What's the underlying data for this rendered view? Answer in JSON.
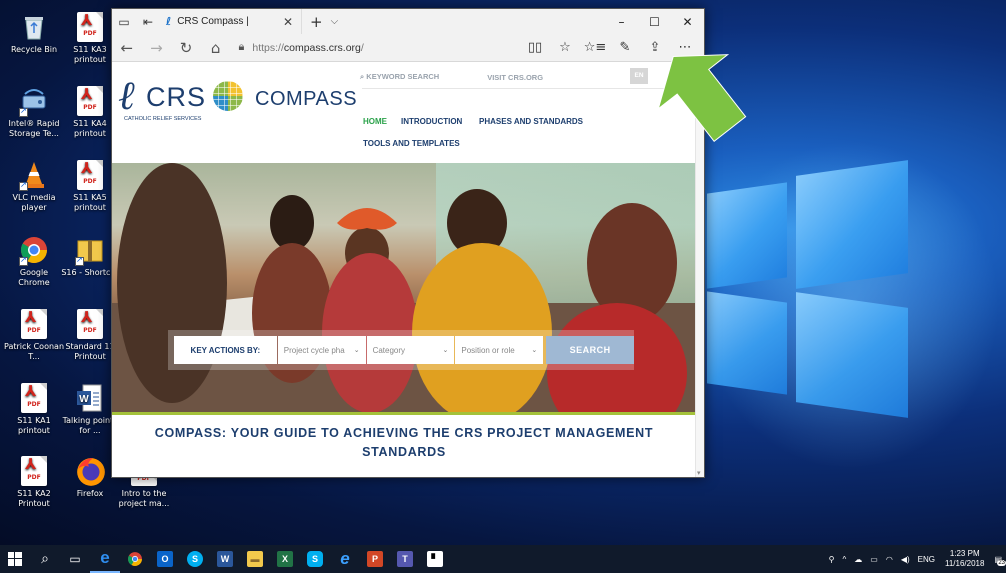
{
  "desktop": {
    "icons_col1": [
      {
        "label": "Recycle Bin"
      },
      {
        "label": "Intel® Rapid Storage Te..."
      },
      {
        "label": "VLC media player"
      },
      {
        "label": "Google Chrome"
      },
      {
        "label": "Patrick Coonan T..."
      },
      {
        "label": "S11 KA1 printout"
      },
      {
        "label": "S11 KA2 Printout"
      }
    ],
    "icons_col2": [
      {
        "label": "S11 KA3 printout"
      },
      {
        "label": "S11 KA4 printout"
      },
      {
        "label": "S11 KA5 printout"
      },
      {
        "label": "S16 - Shortcut"
      },
      {
        "label": "Standard 11 Printout"
      },
      {
        "label": "Talking points for ..."
      },
      {
        "label": "Firefox"
      }
    ],
    "icon_col3": {
      "label": "Intro to the project ma..."
    },
    "pdf_tag": "PDF"
  },
  "browser": {
    "tab_title": "CRS Compass |",
    "url_prefix": "https://",
    "url_host": "compass.crs.org",
    "url_suffix": "/",
    "new_tab_symbol": "+",
    "tab_close": "✕"
  },
  "site": {
    "logo_text": "CRS",
    "logo_subtext": "CATHOLIC RELIEF SERVICES",
    "compass_word": "COMPASS",
    "keyword_search": "KEYWORD SEARCH",
    "visit_link": "VISIT CRS.ORG",
    "lang": "EN",
    "menu": {
      "home": "HOME",
      "introduction": "INTRODUCTION",
      "phases": "PHASES AND STANDARDS",
      "tools": "TOOLS AND TEMPLATES"
    },
    "search": {
      "label": "KEY ACTIONS BY:",
      "phase_placeholder": "Project cycle pha",
      "category_placeholder": "Category",
      "role_placeholder": "Position or role",
      "button": "SEARCH"
    },
    "guide_line1": "COMPASS: YOUR GUIDE TO ACHIEVING THE CRS PROJECT MANAGEMENT",
    "guide_line2": "STANDARDS"
  },
  "taskbar": {
    "time": "1:23 PM",
    "date": "11/16/2018",
    "lang": "ENG",
    "notif_count": "23"
  },
  "colors": {
    "crs_blue": "#1d3e6e",
    "home_green": "#2aa24a",
    "accent_green": "#a4c23a",
    "search_button": "#9fb8d3",
    "arrow_green": "#7dc242"
  }
}
